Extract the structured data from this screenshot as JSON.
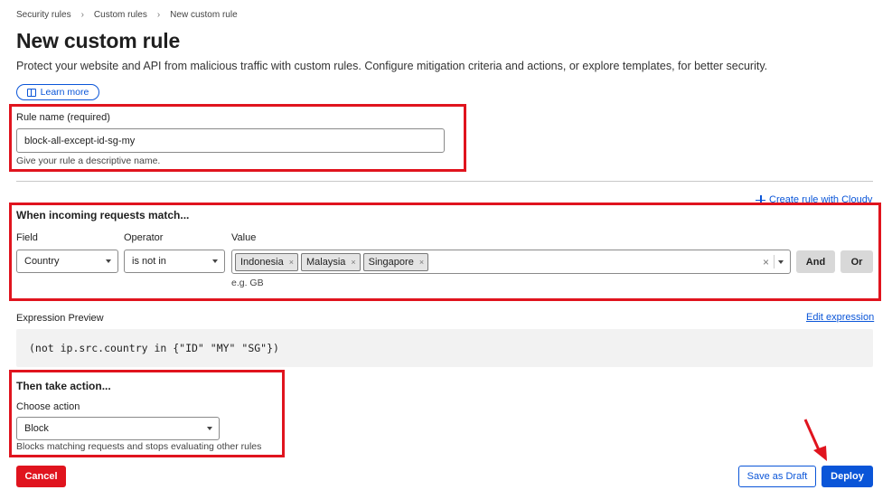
{
  "breadcrumb": {
    "items": [
      "Security rules",
      "Custom rules",
      "New custom rule"
    ]
  },
  "page": {
    "title": "New custom rule",
    "subtitle": "Protect your website and API from malicious traffic with custom rules. Configure mitigation criteria and actions, or explore templates, for better security.",
    "learn_more": "Learn more"
  },
  "rule_name": {
    "label": "Rule name (required)",
    "value": "block-all-except-id-sg-my",
    "help": "Give your rule a descriptive name."
  },
  "cloudy_link": "Create rule with Cloudy",
  "match": {
    "title": "When incoming requests match...",
    "field_label": "Field",
    "operator_label": "Operator",
    "value_label": "Value",
    "field_value": "Country",
    "operator_value": "is not in",
    "values": [
      "Indonesia",
      "Malaysia",
      "Singapore"
    ],
    "value_hint": "e.g. GB",
    "and_label": "And",
    "or_label": "Or"
  },
  "expression": {
    "label": "Expression Preview",
    "edit_link": "Edit expression",
    "code": "(not ip.src.country in {\"ID\" \"MY\" \"SG\"})"
  },
  "action": {
    "title": "Then take action...",
    "choose_label": "Choose action",
    "value": "Block",
    "help": "Blocks matching requests and stops evaluating other rules"
  },
  "footer": {
    "cancel": "Cancel",
    "save_draft": "Save as Draft",
    "deploy": "Deploy"
  },
  "colors": {
    "accent": "#0a55d8",
    "danger": "#e0141e",
    "annotation": "#e0141e"
  },
  "icons": {
    "breadcrumb_sep": "›",
    "chip_remove": "×",
    "clear": "×"
  }
}
